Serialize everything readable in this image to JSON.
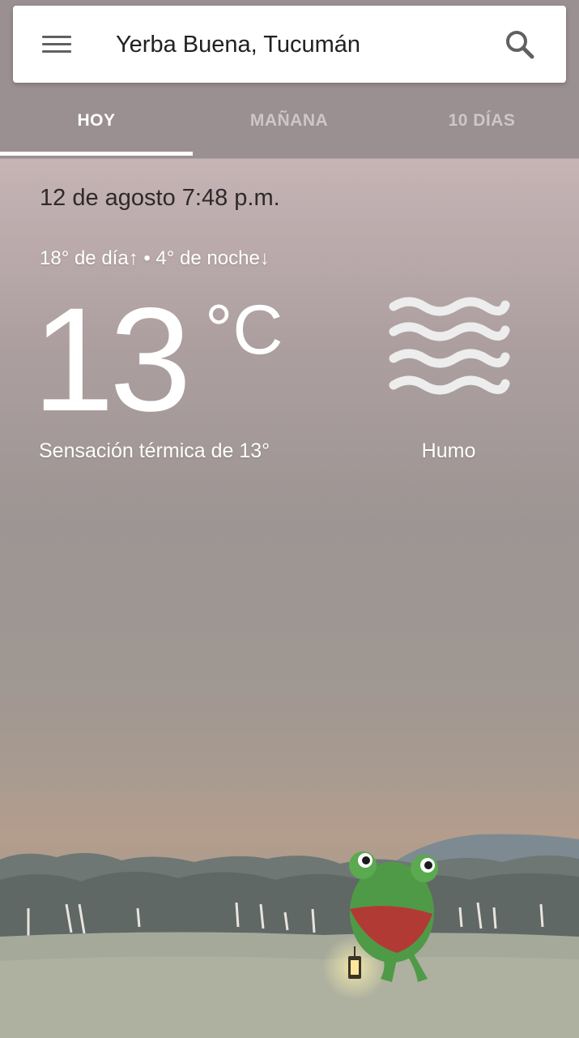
{
  "search": {
    "location": "Yerba Buena, Tucumán",
    "menu_icon": "menu-icon",
    "search_icon": "search-icon"
  },
  "tabs": [
    {
      "label": "HOY",
      "active": true
    },
    {
      "label": "MAÑANA",
      "active": false
    },
    {
      "label": "10 DÍAS",
      "active": false
    }
  ],
  "weather": {
    "datetime": "12 de agosto 7:48 p.m.",
    "hi_lo": "18° de día↑ • 4° de noche↓",
    "temperature": "13",
    "unit": "°C",
    "feels_like": "Sensación térmica de 13°",
    "condition": "Humo",
    "condition_icon": "haze-icon"
  },
  "colors": {
    "tab_bar": "#9b9091",
    "sky_top": "#c6b4b5",
    "sky_horizon": "#b49d8c"
  }
}
